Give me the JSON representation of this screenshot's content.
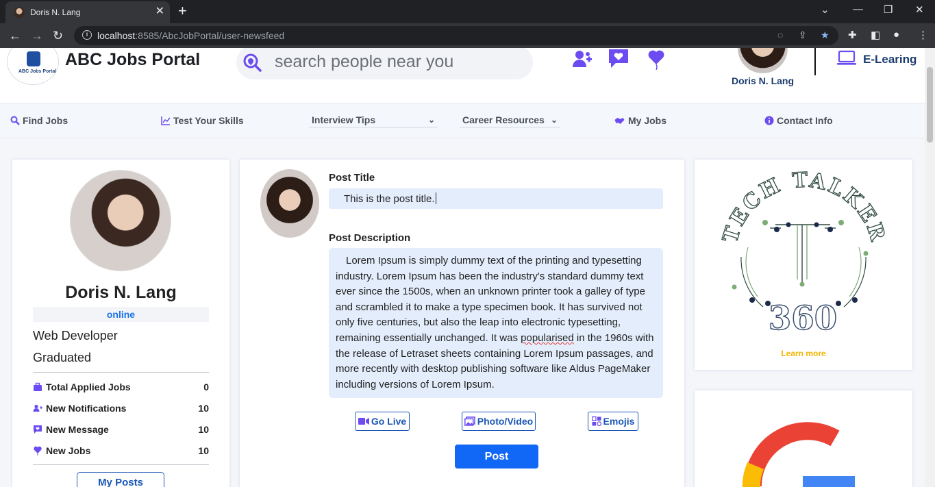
{
  "browser": {
    "tab_title": "Doris N. Lang",
    "url_host": "localhost",
    "url_rest": ":8585/AbcJobPortal/user-newsfeed"
  },
  "header": {
    "brand": "ABC Jobs Portal",
    "logo_text": "ABC Jobs Portal",
    "search_placeholder": "search people near you",
    "user_name": "Doris N. Lang",
    "elearning_label": "E-Learing"
  },
  "menu": {
    "find_jobs": "Find Jobs",
    "test_skills": "Test Your Skills",
    "interview_tips": "Interview Tips",
    "career_resources": "Career Resources",
    "my_jobs": "My Jobs",
    "contact_info": "Contact Info"
  },
  "profile": {
    "name": "Doris N. Lang",
    "status": "online",
    "role": "Web Developer",
    "education": "Graduated",
    "stats": [
      {
        "label": "Total Applied Jobs",
        "value": "0"
      },
      {
        "label": "New Notifications",
        "value": "10"
      },
      {
        "label": "New Message",
        "value": "10"
      },
      {
        "label": "New Jobs",
        "value": "10"
      }
    ],
    "my_posts_label": "My Posts"
  },
  "post": {
    "title_label": "Post Title",
    "title_value": "This is the post title.",
    "description_label": "Post Description",
    "description_before": "Lorem Ipsum is simply dummy text of the printing and typesetting industry. Lorem Ipsum has been the industry's standard dummy text ever since the 1500s, when an unknown printer took a galley of type and scrambled it to make a type specimen book. It has survived not only five centuries, but also the leap into electronic typesetting, remaining essentially unchanged. It was ",
    "description_misspelled": "popularised",
    "description_after": " in the 1960s with the release of Letraset sheets containing Lorem Ipsum passages, and more recently with desktop publishing software like Aldus PageMaker including versions of Lorem Ipsum.",
    "go_live_label": "Go Live",
    "photo_video_label": "Photo/Video",
    "emojis_label": "Emojis",
    "post_button_label": "Post"
  },
  "ads": {
    "tech_talker_top": "TECH TALKER",
    "tech_talker_bottom": "360",
    "learn_more": "Learn more"
  },
  "colors": {
    "accent": "#1168f7",
    "nav_purple": "#6c4cf0",
    "brand_navy": "#1a3c6e",
    "learn_more": "#f4b400"
  }
}
